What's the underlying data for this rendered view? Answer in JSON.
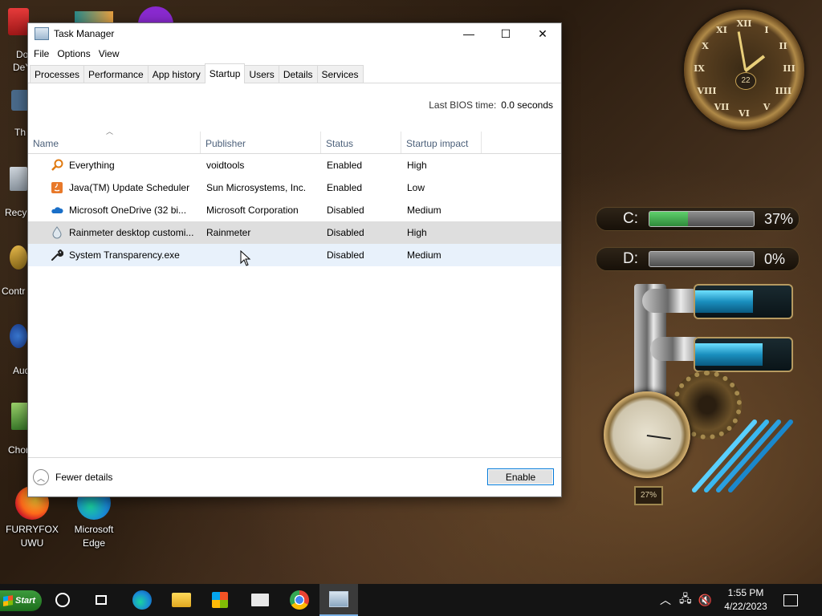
{
  "desktop": {
    "icons_left": [
      {
        "label": "Do",
        "label2": "DeY"
      },
      {
        "label": "Th"
      },
      {
        "label": "Recy"
      },
      {
        "label": "Contr"
      },
      {
        "label": "Aud"
      },
      {
        "label": "Chor"
      }
    ],
    "icons_bottom": [
      {
        "label": "FURRYFOX UWU"
      },
      {
        "label": "Microsoft Edge"
      }
    ]
  },
  "window": {
    "title": "Task Manager",
    "controls": {
      "minimize": "—",
      "maximize": "☐",
      "close": "✕"
    },
    "menu": [
      "File",
      "Options",
      "View"
    ],
    "tabs": [
      "Processes",
      "Performance",
      "App history",
      "Startup",
      "Users",
      "Details",
      "Services"
    ],
    "active_tab": "Startup",
    "bios_label": "Last BIOS time:",
    "bios_value": "0.0 seconds",
    "columns": [
      "Name",
      "Publisher",
      "Status",
      "Startup impact"
    ],
    "rows": [
      {
        "name": "Everything",
        "publisher": "voidtools",
        "status": "Enabled",
        "impact": "High",
        "icon": "search-icon"
      },
      {
        "name": "Java(TM) Update Scheduler",
        "publisher": "Sun Microsystems, Inc.",
        "status": "Enabled",
        "impact": "Low",
        "icon": "java-icon"
      },
      {
        "name": "Microsoft OneDrive (32 bi...",
        "publisher": "Microsoft Corporation",
        "status": "Disabled",
        "impact": "Medium",
        "icon": "cloud-icon"
      },
      {
        "name": "Rainmeter desktop customi...",
        "publisher": "Rainmeter",
        "status": "Disabled",
        "impact": "High",
        "icon": "drop-icon"
      },
      {
        "name": "System Transparency.exe",
        "publisher": "",
        "status": "Disabled",
        "impact": "Medium",
        "icon": "wrench-icon"
      }
    ],
    "footer": {
      "fewer_details": "Fewer details",
      "enable_button": "Enable"
    }
  },
  "widgets": {
    "clock_numerals": [
      "XII",
      "I",
      "II",
      "III",
      "IIII",
      "V",
      "VI",
      "VII",
      "VIII",
      "IX",
      "X",
      "XI"
    ],
    "clock_date": "22",
    "drives": [
      {
        "label": "C:",
        "percent": "37%",
        "fill": 0.37
      },
      {
        "label": "D:",
        "percent": "0%",
        "fill": 0.0
      }
    ],
    "gauge_percent": "27%"
  },
  "taskbar": {
    "start_label": "Start",
    "time": "1:55 PM",
    "date": "4/22/2023"
  },
  "colors": {
    "accent": "#0078d7",
    "hover_row": "#dedede",
    "selected_row": "#e8f1fb",
    "header_text": "#4c607a"
  }
}
